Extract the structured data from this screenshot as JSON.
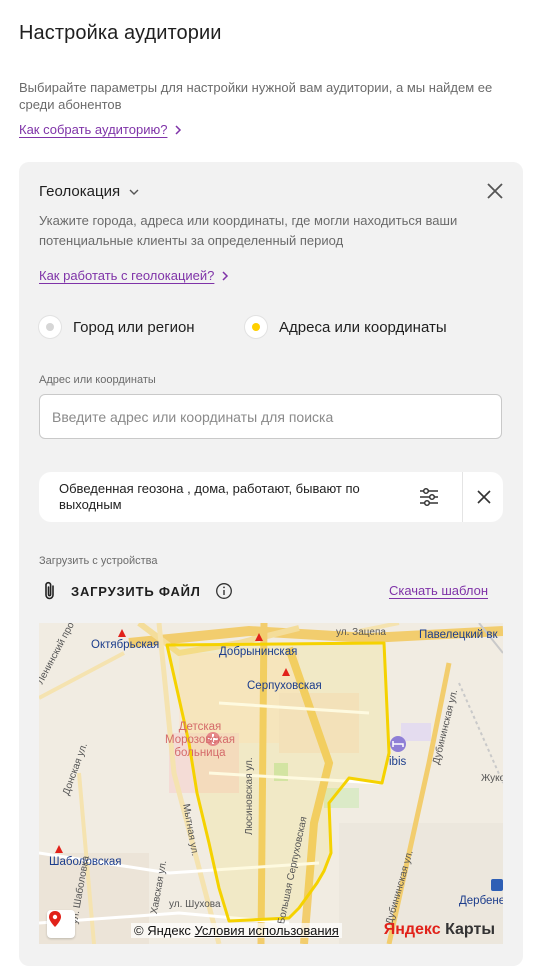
{
  "page": {
    "title": "Настройка аудитории",
    "intro": "Выбирайте параметры для настройки нужной вам аудитории, а мы найдем ее среди абонентов",
    "how_collect_link": "Как собрать аудиторию?"
  },
  "geo_card": {
    "title": "Геолокация",
    "description": "Укажите города, адреса или координаты, где могли находиться ваши потенциальные клиенты за определенный период",
    "how_link": "Как работать с геолокацией?",
    "radio_options": [
      {
        "label": "Город или регион",
        "selected": false
      },
      {
        "label": "Адреса или координаты",
        "selected": true
      }
    ],
    "address_field": {
      "label": "Адрес или координаты",
      "placeholder": "Введите адрес или координаты для поиска",
      "value": ""
    },
    "geozone": "Обведенная геозона , дома, работают, бывают по выходным",
    "upload": {
      "label": "Загрузить с устройства",
      "button": "ЗАГРУЗИТЬ ФАЙЛ",
      "download_template": "Скачать шаблон"
    }
  },
  "map": {
    "labels": {
      "oktyabrskaya": "Октябрьская",
      "dobryninskaya": "Добрынинская",
      "serpukhovskaya": "Серпуховская",
      "paveletsky": "Павелецкий вк",
      "zatsepa": "ул. Зацепа",
      "leninsky": "Ленинский просп.",
      "donskaya": "Донская ул.",
      "hospital": "Детская Морозовская больница",
      "lyusinovskaya": "Люсиновская ул.",
      "mytnaya": "Мытная ул.",
      "b_serpukhovskaya": "Большая Серпуховская",
      "ibis": "ibis",
      "dubininskaya": "Дубининская ул.",
      "dubininskaya2": "Дубининская ул.",
      "shabolovskaya": "Шаболовская",
      "shabolovka": "ул. Шаболовка",
      "khavskaya": "Хавская ул.",
      "shukhova": "ул. Шухова",
      "zhuk": "Жуко",
      "derbe": "Дербене",
      "attribution": "© Яндекс",
      "terms": "Условия использования",
      "logo_y": "Яндекс",
      "logo_rest": " Карты"
    },
    "colors": {
      "geozone": "#f5d200",
      "road": "#f7d98a",
      "metro": "#e1221a"
    }
  }
}
